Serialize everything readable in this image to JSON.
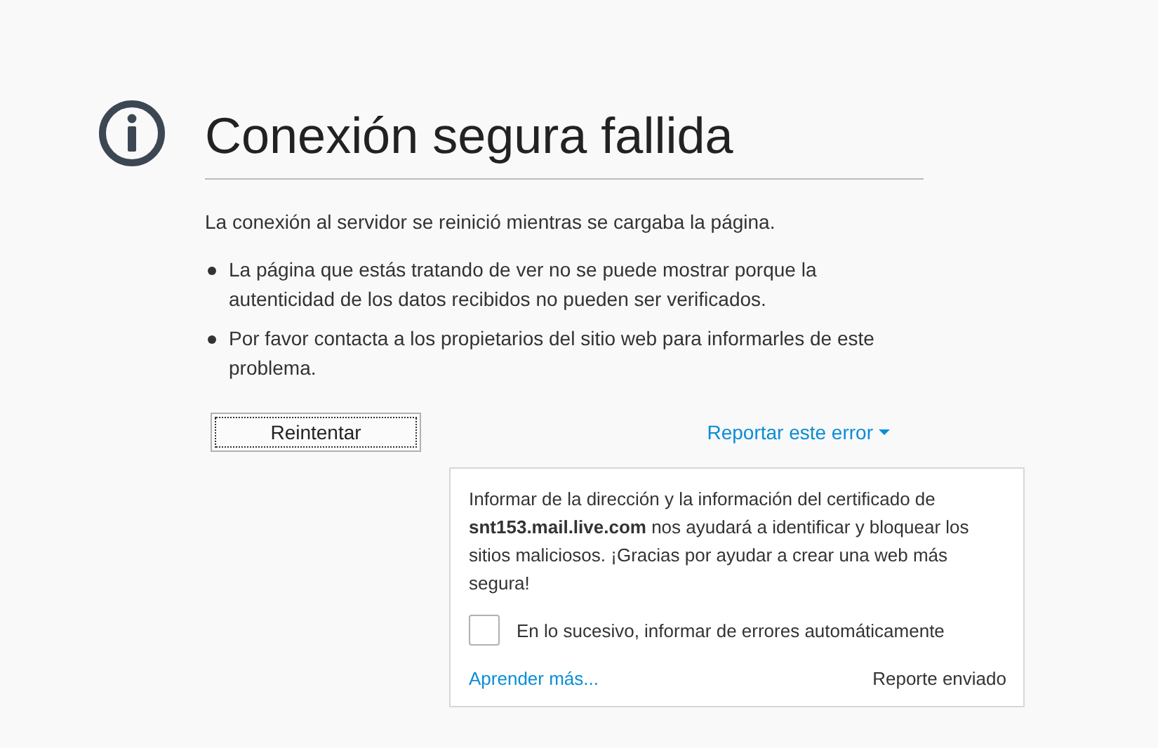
{
  "title": "Conexión segura fallida",
  "message": "La conexión al servidor se reinició mientras se cargaba la página.",
  "bullets": [
    "La página que estás tratando de ver no se puede mostrar porque la autenticidad de los datos recibidos no pueden ser verificados.",
    "Por favor contacta a los propietarios del sitio web para informarles de este problema."
  ],
  "retry_button": "Reintentar",
  "report_link": {
    "label": "Reportar este error",
    "expanded": true
  },
  "report_panel": {
    "text": "Informar de la dirección y la información del certificado de **snt153.mail.live.com** nos ayudará a identificar y bloquear los sitios maliciosos. ¡Gracias por ayudar a crear una web más segura!",
    "checkbox": {
      "label": "En lo sucesivo, informar de errores automáticamente",
      "checked": false
    },
    "learn_more": "Aprender más...",
    "status": "Reporte enviado"
  }
}
